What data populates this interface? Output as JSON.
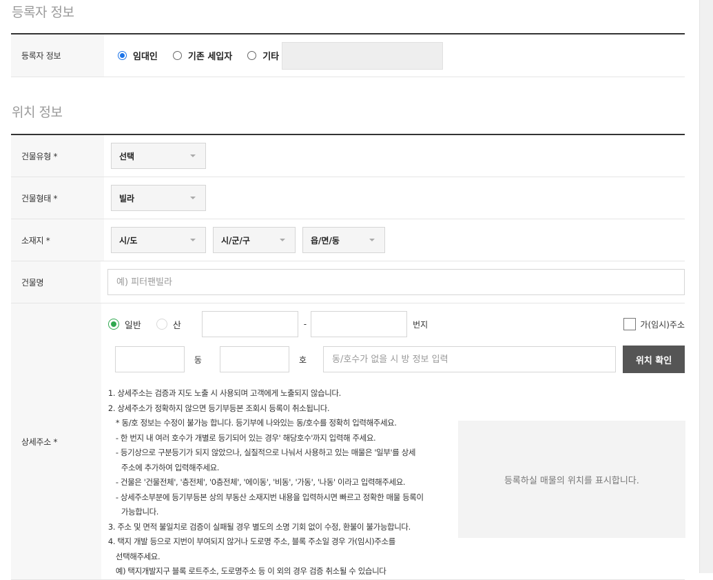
{
  "registrant_section": {
    "title": "등록자 정보",
    "label": "등록자 정보",
    "options": [
      "임대인",
      "기존 세입자",
      "기타"
    ],
    "selected": "임대인"
  },
  "location_section": {
    "title": "위치 정보",
    "building_type": {
      "label": "건물유형 *",
      "value": "선택"
    },
    "building_form": {
      "label": "건물형태 *",
      "value": "빌라"
    },
    "address": {
      "label": "소재지 *",
      "sido": "시/도",
      "sigungu": "시/군/구",
      "eupmyeondong": "읍/면/동"
    },
    "building_name": {
      "label": "건물명",
      "placeholder": "예) 피터팬빌라"
    },
    "detail": {
      "label": "상세주소 *",
      "lot_general": "일반",
      "lot_mountain": "산",
      "dash": "-",
      "beonji": "번지",
      "temp_address": "가(임시)주소",
      "dong": "동",
      "ho": "호",
      "room_placeholder": "동/호수가 없을 시 방 정보 입력",
      "confirm_button": "위치 확인",
      "map_placeholder": "등록하실 매물의 위치를 표시합니다."
    },
    "notes": [
      "1. 상세주소는 검증과 지도 노출 시 사용되며 고객에게 노출되지 않습니다.",
      "2. 상세주소가 정확하지 않으면 등기부등본 조회시 등록이 취소됩니다.",
      "* 동/호 정보는 수정이 불가능 합니다. 등기부에 나와있는 동/호수를 정확히 입력해주세요.",
      "- 한 번지 내 여러 호수가 개별로 등기되어 있는 경우' 해당호수'까지 입력해 주세요.",
      "- 등기상으로 구분등기가 되지 않았으나, 실질적으로 나눠서 사용하고 있는 매물은 '일부'를 상세",
      "주소에 추가하여 입력해주세요.",
      "- 건물은 '건물전체', '층전체', '0층전체', '에이동', '비동', '가동', '나동' 이라고 입력해주세요.",
      "- 상세주소부분에 등기부등본 상의 부동산 소재지번 내용을 입력하시면 빠르고 정확한 매물 등록이",
      "가능합니다.",
      "3. 주소 및 면적 불일치로 검증이 실패될 경우 별도의 소명 기회 없이 수정, 환불이 불가능합니다.",
      "4. 택지 개발 등으로 지번이 부여되지 않거나 도로명 주소, 블록 주소일 경우 가(임시)주소를",
      "선택해주세요.",
      "예) 택지개발지구 블록 로트주소, 도로명주소 등 이 외의 경우 검증 취소될 수 있습니다"
    ]
  }
}
